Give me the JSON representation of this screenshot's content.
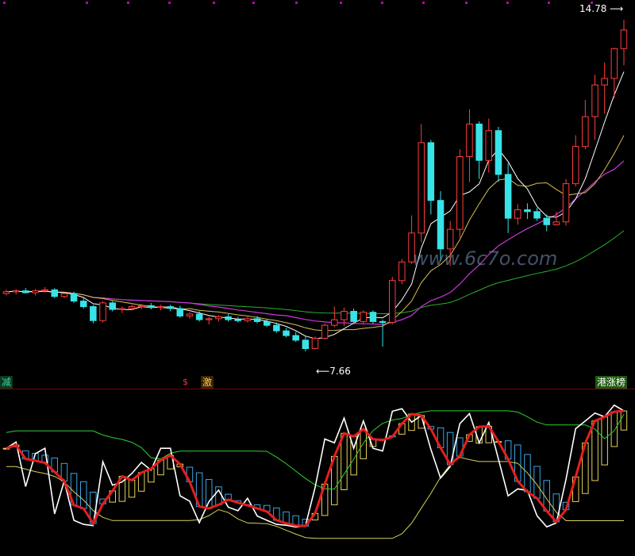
{
  "chart_data": [
    {
      "type": "candlestick",
      "panel": "main",
      "annotations": {
        "high_label": "14.78",
        "low_label": "7.66"
      },
      "signals": [
        {
          "text": "减",
          "color": "#40d0a0",
          "bg": "#0c3a20"
        },
        {
          "text": "$",
          "color": "#ff3030"
        },
        {
          "text": "激",
          "color": "#ffcc44",
          "bg": "#3a2408"
        },
        {
          "text": "港涨榜",
          "color": "#ffffff",
          "bg": "#1c5a10"
        }
      ],
      "watermark": "www.6c7o.com",
      "candles": [
        [
          8.9,
          8.98,
          8.86,
          8.94
        ],
        [
          8.94,
          9.0,
          8.88,
          8.96
        ],
        [
          8.96,
          9.02,
          8.9,
          8.92
        ],
        [
          8.92,
          9.0,
          8.86,
          8.96
        ],
        [
          8.96,
          9.04,
          8.92,
          8.98
        ],
        [
          8.98,
          9.02,
          8.8,
          8.84
        ],
        [
          8.84,
          8.92,
          8.8,
          8.9
        ],
        [
          8.9,
          8.94,
          8.7,
          8.74
        ],
        [
          8.74,
          8.8,
          8.58,
          8.62
        ],
        [
          8.62,
          8.66,
          8.26,
          8.32
        ],
        [
          8.32,
          8.74,
          8.28,
          8.7
        ],
        [
          8.7,
          8.74,
          8.52,
          8.56
        ],
        [
          8.56,
          8.62,
          8.48,
          8.58
        ],
        [
          8.58,
          8.66,
          8.54,
          8.62
        ],
        [
          8.62,
          8.68,
          8.56,
          8.64
        ],
        [
          8.64,
          8.7,
          8.56,
          8.6
        ],
        [
          8.6,
          8.66,
          8.54,
          8.62
        ],
        [
          8.62,
          8.66,
          8.52,
          8.58
        ],
        [
          8.58,
          8.64,
          8.38,
          8.42
        ],
        [
          8.42,
          8.5,
          8.36,
          8.46
        ],
        [
          8.46,
          8.52,
          8.3,
          8.34
        ],
        [
          8.34,
          8.4,
          8.24,
          8.36
        ],
        [
          8.36,
          8.44,
          8.3,
          8.4
        ],
        [
          8.4,
          8.46,
          8.3,
          8.34
        ],
        [
          8.34,
          8.4,
          8.28,
          8.32
        ],
        [
          8.32,
          8.4,
          8.28,
          8.36
        ],
        [
          8.36,
          8.42,
          8.26,
          8.3
        ],
        [
          8.3,
          8.36,
          8.18,
          8.22
        ],
        [
          8.22,
          8.28,
          8.06,
          8.1
        ],
        [
          8.1,
          8.16,
          7.96,
          8.0
        ],
        [
          8.0,
          8.08,
          7.86,
          7.9
        ],
        [
          7.9,
          7.98,
          7.66,
          7.72
        ],
        [
          7.72,
          7.98,
          7.7,
          7.94
        ],
        [
          7.94,
          8.26,
          7.92,
          8.22
        ],
        [
          8.22,
          8.62,
          8.18,
          8.34
        ],
        [
          8.34,
          8.6,
          8.2,
          8.52
        ],
        [
          8.52,
          8.58,
          8.26,
          8.3
        ],
        [
          8.3,
          8.54,
          8.24,
          8.5
        ],
        [
          8.5,
          8.54,
          8.26,
          8.3
        ],
        [
          8.3,
          8.34,
          7.76,
          8.28
        ],
        [
          8.28,
          9.26,
          8.24,
          9.18
        ],
        [
          9.18,
          9.64,
          9.1,
          9.58
        ],
        [
          9.58,
          10.58,
          9.54,
          10.2
        ],
        [
          10.2,
          12.54,
          10.0,
          12.14
        ],
        [
          12.14,
          12.2,
          10.6,
          10.9
        ],
        [
          10.9,
          11.1,
          9.6,
          9.86
        ],
        [
          9.86,
          10.46,
          9.5,
          10.28
        ],
        [
          10.28,
          12.0,
          10.1,
          11.84
        ],
        [
          11.84,
          12.86,
          11.3,
          12.54
        ],
        [
          12.54,
          12.6,
          11.36,
          11.76
        ],
        [
          11.76,
          12.66,
          11.5,
          12.4
        ],
        [
          12.4,
          12.48,
          11.3,
          11.46
        ],
        [
          11.46,
          11.7,
          10.2,
          10.52
        ],
        [
          10.52,
          10.82,
          10.38,
          10.7
        ],
        [
          10.7,
          10.84,
          10.5,
          10.66
        ],
        [
          10.66,
          10.74,
          10.46,
          10.52
        ],
        [
          10.52,
          10.6,
          10.24,
          10.38
        ],
        [
          10.38,
          10.66,
          10.36,
          10.44
        ],
        [
          10.44,
          11.36,
          10.36,
          11.26
        ],
        [
          11.26,
          12.3,
          11.2,
          12.06
        ],
        [
          12.06,
          13.06,
          12.0,
          12.7
        ],
        [
          12.7,
          13.6,
          12.2,
          13.38
        ],
        [
          13.38,
          13.86,
          12.76,
          13.52
        ],
        [
          13.52,
          14.18,
          13.1,
          14.16
        ],
        [
          14.16,
          14.78,
          13.8,
          14.56
        ]
      ]
    },
    {
      "type": "oscillator",
      "panel": "sub",
      "bar_colors": {
        "up": "#e6d25a",
        "down": "#3aa6e6"
      },
      "line_colors": {
        "white": "#ffffff",
        "red": "#e81d1d",
        "green": "#2ed12e",
        "yellow": "#d8d05a"
      }
    }
  ]
}
